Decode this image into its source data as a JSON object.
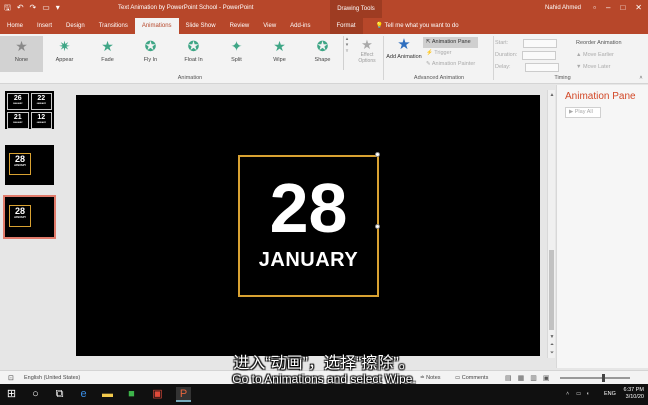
{
  "window": {
    "title": "Text Animation by PowerPoint School - PowerPoint",
    "context_tab": "Drawing Tools",
    "tell_me": "Tell me what you want to do",
    "user": "Nahid Ahmed",
    "accent_color": "#b7472a"
  },
  "tabs": [
    {
      "label": "Home"
    },
    {
      "label": "Insert"
    },
    {
      "label": "Design"
    },
    {
      "label": "Transitions"
    },
    {
      "label": "Animations"
    },
    {
      "label": "Slide Show"
    },
    {
      "label": "Review"
    },
    {
      "label": "View"
    },
    {
      "label": "Add-ins"
    },
    {
      "label": "Format"
    }
  ],
  "ribbon": {
    "animations": [
      {
        "label": "None"
      },
      {
        "label": "Appear"
      },
      {
        "label": "Fade"
      },
      {
        "label": "Fly In"
      },
      {
        "label": "Float In"
      },
      {
        "label": "Split"
      },
      {
        "label": "Wipe"
      },
      {
        "label": "Shape"
      }
    ],
    "effect_options": "Effect Options",
    "animation_group": "Animation",
    "add_animation": "Add Animation",
    "animation_pane": "Animation Pane",
    "trigger": "Trigger",
    "animation_painter": "Animation Painter",
    "advanced_group": "Advanced Animation",
    "start": "Start:",
    "duration": "Duration:",
    "delay": "Delay:",
    "timing_group": "Timing",
    "reorder_title": "Reorder Animation",
    "move_earlier": "Move Earlier",
    "move_later": "Move Later"
  },
  "thumbnails": {
    "grid": [
      {
        "num": "26",
        "month": "JANUARY"
      },
      {
        "num": "22",
        "month": "JANUARY"
      },
      {
        "num": "21",
        "month": "JANUARY"
      },
      {
        "num": "12",
        "month": "JANUARY"
      }
    ],
    "slide2": {
      "num": "28",
      "month": "JANUARY"
    },
    "slide3": {
      "num": "28",
      "month": "JANUARY"
    }
  },
  "slide": {
    "number": "28",
    "month": "JANUARY",
    "box_color": "#d9a232"
  },
  "pane": {
    "title": "Animation Pane",
    "play": "Play All"
  },
  "subtitles": {
    "cn": "进入“动画”，选择“擦除”。",
    "en": "Go to Animations and select Wipe."
  },
  "status": {
    "language": "English (United States)",
    "notes": "Notes",
    "comments": "Comments"
  },
  "taskbar": {
    "time": "6:37 PM",
    "date": "3/10/20",
    "lang": "ENG"
  }
}
